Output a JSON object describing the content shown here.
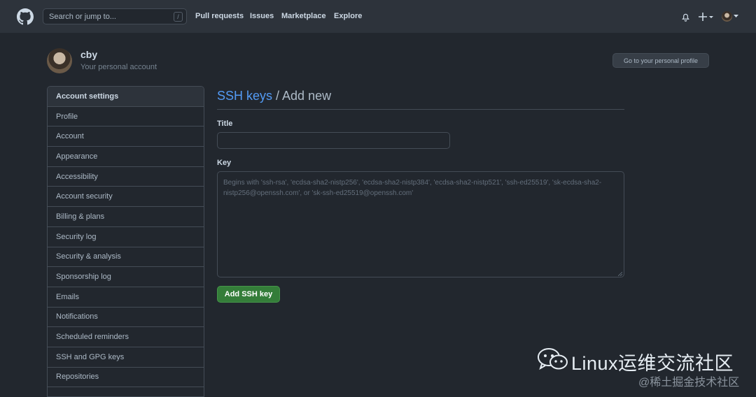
{
  "header": {
    "search_placeholder": "Search or jump to...",
    "search_key": "/",
    "nav": [
      "Pull requests",
      "Issues",
      "Marketplace",
      "Explore"
    ],
    "icons": [
      "github-logo",
      "bell-icon",
      "plus-icon",
      "avatar"
    ]
  },
  "user": {
    "name": "cby",
    "subtitle": "Your personal account",
    "profile_button": "Go to your personal profile"
  },
  "sidebar": {
    "heading": "Account settings",
    "items": [
      "Profile",
      "Account",
      "Appearance",
      "Accessibility",
      "Account security",
      "Billing & plans",
      "Security log",
      "Security & analysis",
      "Sponsorship log",
      "Emails",
      "Notifications",
      "Scheduled reminders",
      "SSH and GPG keys",
      "Repositories"
    ]
  },
  "main": {
    "breadcrumb_link": "SSH keys",
    "breadcrumb_rest": " / Add new",
    "title_label": "Title",
    "title_value": "",
    "key_label": "Key",
    "key_placeholder": "Begins with 'ssh-rsa', 'ecdsa-sha2-nistp256', 'ecdsa-sha2-nistp384', 'ecdsa-sha2-nistp521', 'ssh-ed25519', 'sk-ecdsa-sha2-nistp256@openssh.com', or 'sk-ssh-ed25519@openssh.com'",
    "submit_label": "Add SSH key"
  },
  "watermark": {
    "title": "Linux运维交流社区",
    "sub": "@稀土掘金技术社区"
  },
  "colors": {
    "background": "#22272e",
    "header": "#2d333b",
    "link": "#539bf5",
    "button_green": "#347d39"
  }
}
